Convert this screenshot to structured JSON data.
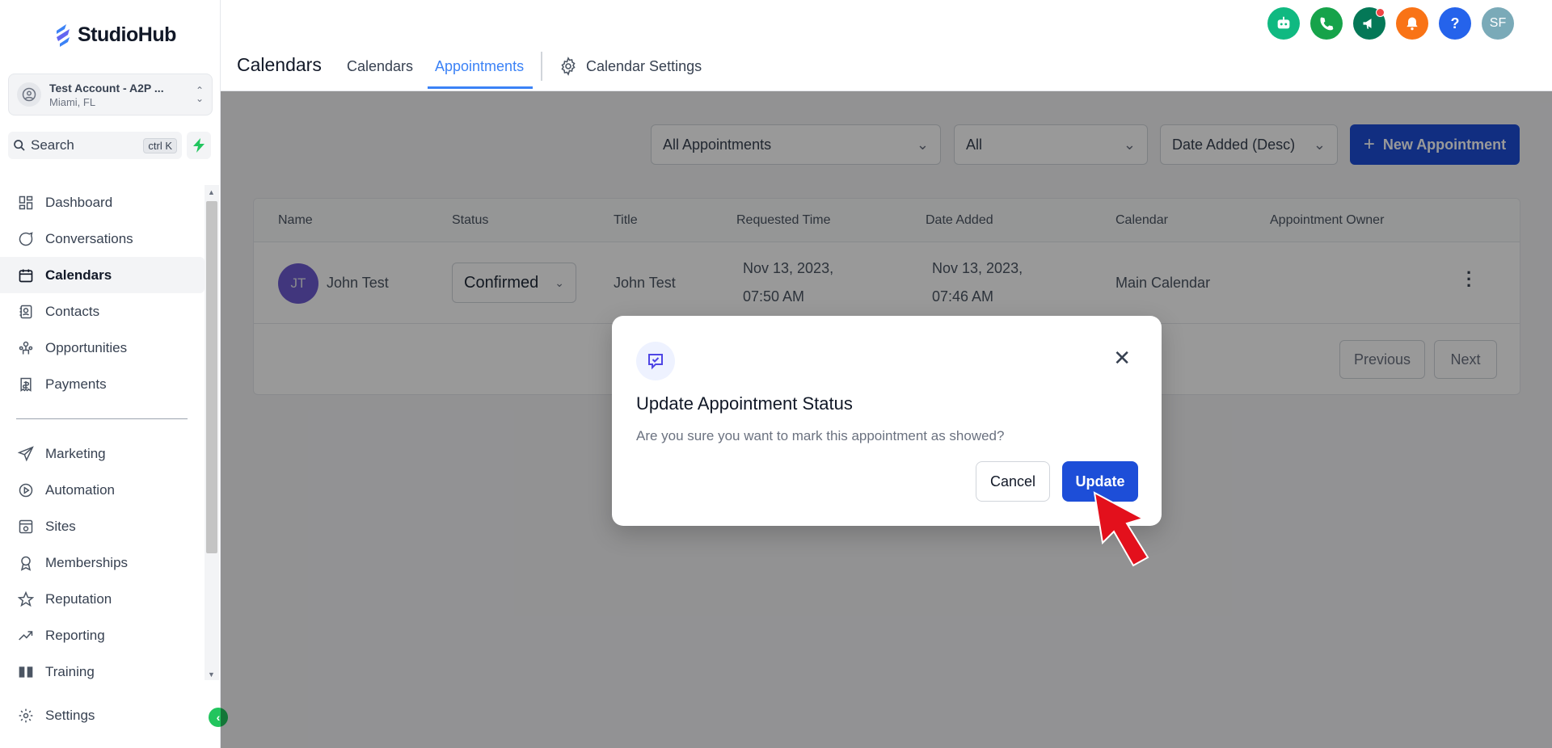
{
  "app": {
    "name": "StudioHub"
  },
  "account": {
    "name": "Test Account - A2P ...",
    "location": "Miami, FL"
  },
  "search": {
    "label": "Search",
    "shortcut": "ctrl K"
  },
  "sidebar": {
    "items": [
      {
        "label": "Dashboard",
        "icon": "dashboard-icon"
      },
      {
        "label": "Conversations",
        "icon": "chat-icon"
      },
      {
        "label": "Calendars",
        "icon": "calendar-icon",
        "active": true
      },
      {
        "label": "Contacts",
        "icon": "contacts-icon"
      },
      {
        "label": "Opportunities",
        "icon": "opportunities-icon"
      },
      {
        "label": "Payments",
        "icon": "payments-icon"
      }
    ],
    "items2": [
      {
        "label": "Marketing",
        "icon": "send-icon"
      },
      {
        "label": "Automation",
        "icon": "automation-icon"
      },
      {
        "label": "Sites",
        "icon": "sites-icon"
      },
      {
        "label": "Memberships",
        "icon": "memberships-icon"
      },
      {
        "label": "Reputation",
        "icon": "star-icon"
      },
      {
        "label": "Reporting",
        "icon": "reporting-icon"
      },
      {
        "label": "Training",
        "icon": "book-icon"
      }
    ],
    "settings": "Settings"
  },
  "header": {
    "title": "Calendars",
    "tabs": [
      {
        "label": "Calendars",
        "active": false
      },
      {
        "label": "Appointments",
        "active": true
      }
    ],
    "settings_tab": "Calendar Settings",
    "avatar_initials": "SF",
    "help_label": "?"
  },
  "top_icons": [
    {
      "name": "bot-icon",
      "color": "#10b981"
    },
    {
      "name": "phone-icon",
      "color": "#16a34a"
    },
    {
      "name": "megaphone-icon",
      "color": "#047857"
    },
    {
      "name": "bell-icon",
      "color": "#f97316"
    },
    {
      "name": "help-icon",
      "color": "#2563eb"
    },
    {
      "name": "avatar",
      "color": "#7aaab8"
    }
  ],
  "filters": {
    "appointments": "All Appointments",
    "status": "All",
    "sort": "Date Added (Desc)",
    "new_button": "New Appointment"
  },
  "table": {
    "columns": [
      "Name",
      "Status",
      "Title",
      "Requested Time",
      "Date Added",
      "Calendar",
      "Appointment Owner"
    ],
    "rows": [
      {
        "initials": "JT",
        "name": "John Test",
        "status": "Confirmed",
        "title": "John Test",
        "requested_line1": "Nov 13, 2023,",
        "requested_line2": "07:50 AM",
        "added_line1": "Nov 13, 2023,",
        "added_line2": "07:46 AM",
        "calendar": "Main Calendar",
        "owner": ""
      }
    ],
    "pager": {
      "previous": "Previous",
      "next": "Next"
    }
  },
  "modal": {
    "title": "Update Appointment Status",
    "message": "Are you sure you want to mark this appointment as showed?",
    "cancel": "Cancel",
    "update": "Update"
  },
  "colors": {
    "primary": "#1d4ed8",
    "accent": "#3b82f6",
    "annotation_arrow": "#e3101c"
  }
}
